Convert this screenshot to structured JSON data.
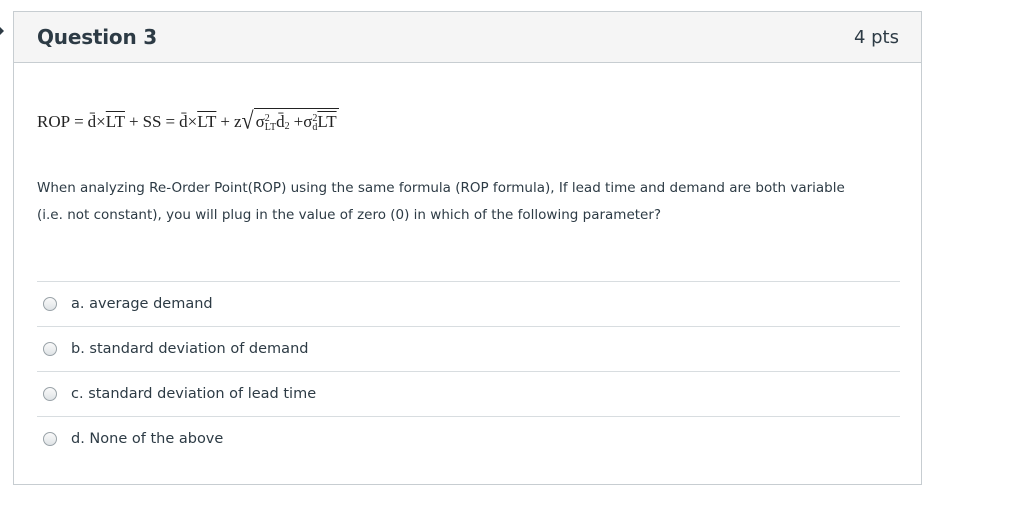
{
  "question": {
    "title": "Question 3",
    "points": "4 pts",
    "formula": {
      "lhs": "ROP",
      "eq1": "=",
      "d_bar": "d̄",
      "times1": "×",
      "lt_bar": "LT",
      "plus1": "+",
      "ss": "SS",
      "eq2": "=",
      "d_bar2": "d̄",
      "times2": "×",
      "lt_bar2": "LT",
      "plus2": "+",
      "z": "z",
      "sigma_lt": "σ",
      "sigma_lt_sup": "2",
      "sigma_lt_sub": "LT",
      "d_bar3": "d̄",
      "d_bar3_sup": "2",
      "plus3": "+",
      "sigma_d": "σ",
      "sigma_d_sup": "2",
      "sigma_d_sub": "d",
      "lt_bar3": "LT"
    },
    "text": "When analyzing Re-Order Point(ROP) using the same formula (ROP formula), If lead time and demand are both variable (i.e. not constant), you will plug in the value of zero (0) in which of the following parameter?",
    "answers": [
      {
        "label": "a. average demand"
      },
      {
        "label": "b. standard deviation of demand"
      },
      {
        "label": "c. standard deviation of lead time"
      },
      {
        "label": "d. None of the above"
      }
    ]
  }
}
